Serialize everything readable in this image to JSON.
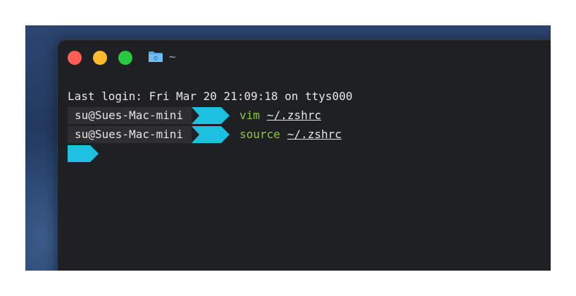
{
  "window": {
    "title": "~",
    "folder_icon": "folder-icon",
    "traffic_lights": {
      "close_color": "#fd5f57",
      "minimize_color": "#febc2e",
      "zoom_color": "#28c840"
    }
  },
  "terminal": {
    "last_login": "Last login: Fri Mar 20 21:09:18 on ttys000",
    "prompts": [
      {
        "user": "su@Sues-Mac-mini",
        "dir": "~",
        "command": "vim",
        "argument": "~/.zshrc"
      },
      {
        "user": "su@Sues-Mac-mini",
        "dir": "~",
        "command": "source",
        "argument": "~/.zshrc"
      }
    ],
    "current_prompt": {
      "dir": "~"
    },
    "colors": {
      "prompt_segment": "#1ec0df",
      "command": "#8fc63f",
      "background": "#1f2023"
    }
  }
}
